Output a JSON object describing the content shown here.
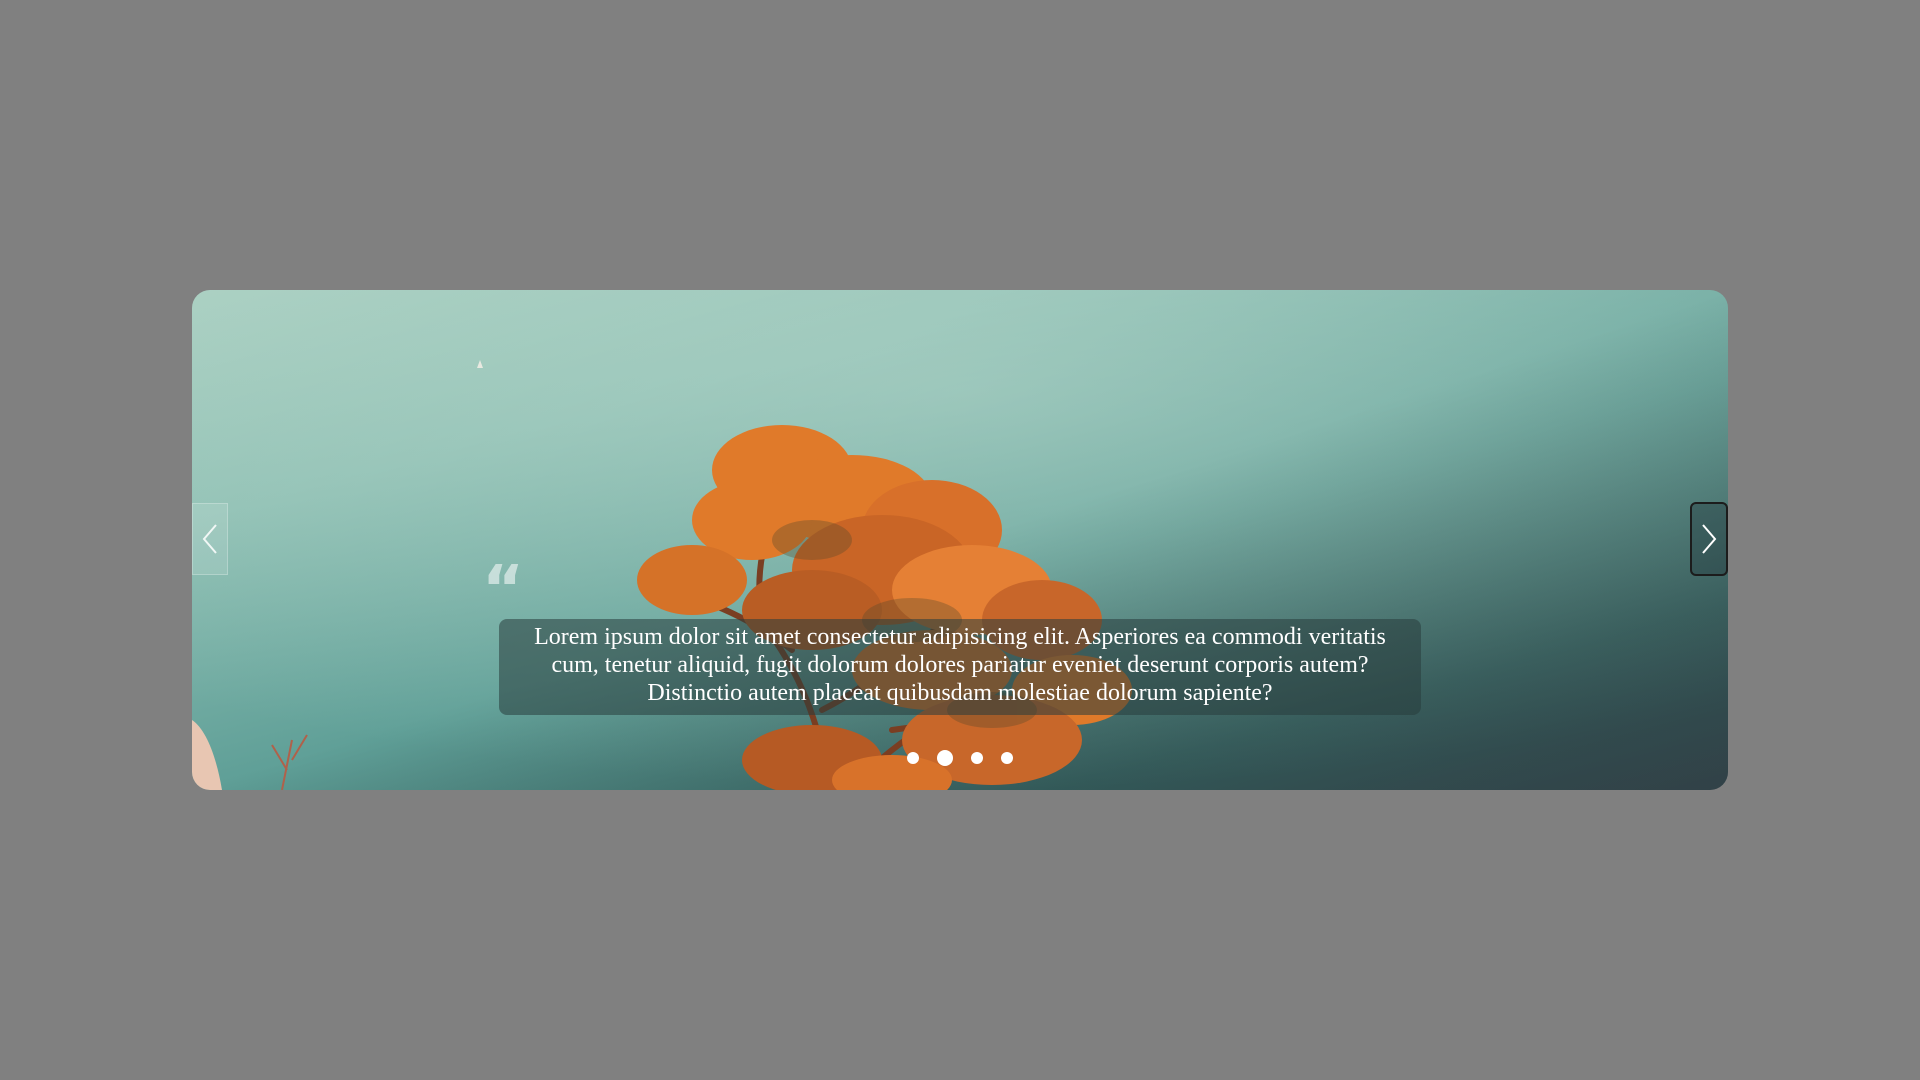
{
  "slider": {
    "caption": "Lorem ipsum dolor sit amet consectetur adipisicing elit. Asperiores ea commodi veritatis cum, tenetur aliquid, fugit dolorum dolores pariatur eveniet deserunt corporis autem? Distinctio autem placeat quibusdam molestiae dolorum sapiente?",
    "quote_icon": "quote-left-icon",
    "prev_icon": "chevron-left-icon",
    "next_icon": "chevron-right-icon",
    "dots_count": 4,
    "active_dot": 2,
    "colors": {
      "page_background": "#808080",
      "caption_text": "#ffffff",
      "foliage": "#e07a2a"
    }
  }
}
